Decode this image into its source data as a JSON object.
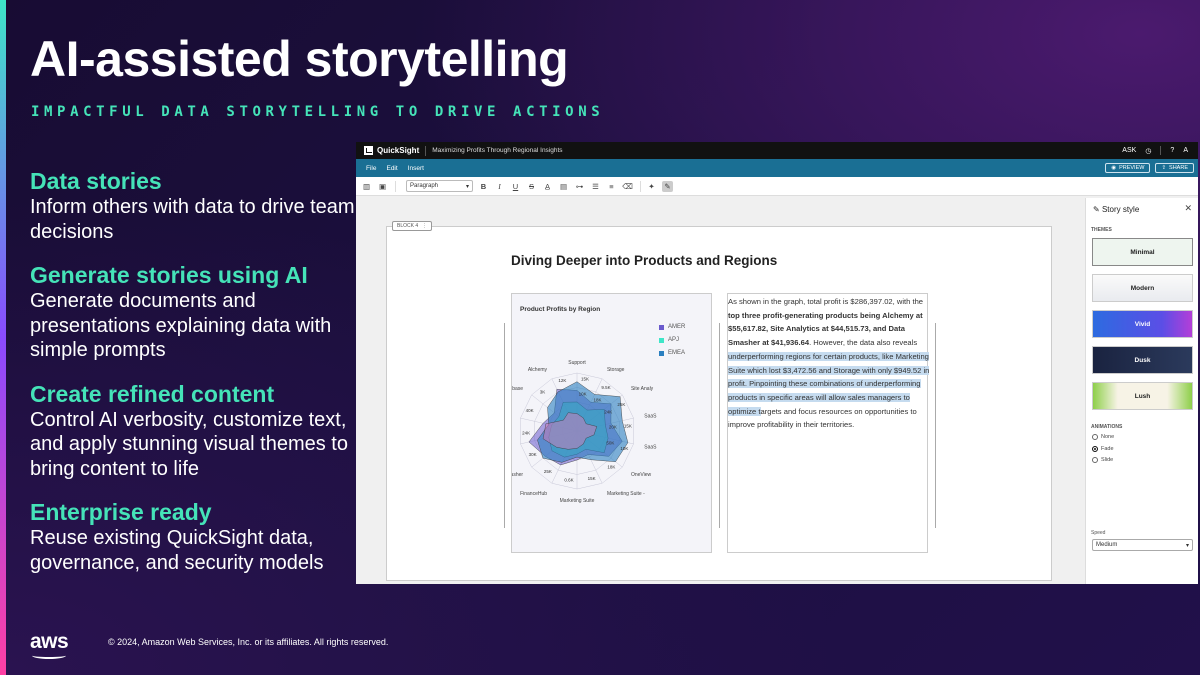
{
  "slide": {
    "title": "AI-assisted storytelling",
    "subtitle": "IMPACTFUL DATA STORYTELLING TO DRIVE ACTIONS",
    "features": [
      {
        "heading": "Data stories",
        "body": "Inform others with data to drive team decisions"
      },
      {
        "heading": "Generate stories using AI",
        "body": "Generate documents and presentations explaining data with simple prompts"
      },
      {
        "heading": "Create refined content",
        "body": "Control AI verbosity, customize text, and apply stunning visual themes to bring content to life"
      },
      {
        "heading": "Enterprise ready",
        "body": "Reuse existing QuickSight data, governance, and security models"
      }
    ],
    "logo": "aws",
    "copyright": "© 2024, Amazon Web Services, Inc. or its affiliates. All rights reserved.",
    "colors": {
      "accent": "#45e3b8",
      "background": "#1c1040"
    }
  },
  "app": {
    "brand": "QuickSight",
    "doc_title": "Maximizing Profits Through Regional Insights",
    "top_right": {
      "ask": "ASK",
      "user": "A"
    },
    "menu": [
      "File",
      "Edit",
      "Insert"
    ],
    "preview_label": "PREVIEW",
    "share_label": "SHARE",
    "paragraph_select": "Paragraph",
    "block_label": "BLOCK 4",
    "story_heading": "Diving Deeper into Products and Regions",
    "chart_title": "Product Profits by Region",
    "story_text": {
      "p1": "As shown in the graph, total profit is $286,397.02, with the ",
      "p1_bold_a": "top three profit-generating products being Alchemy at $55,617.82, Site Analytics at $44,515.73, and Data Smasher at $41,936.64",
      "p1_end": ". However, the data also reveals ",
      "hl_1": "underperforming regions for certain products, like Marketing Suite which lost $3,472.56 and Storage with only $949.52 in profit. Pinpointing these combinations of underperforming products in specific areas will allow sales managers to optimize t",
      "p2": "argets and focus resources on opportunities to improve profitability in their territories."
    },
    "story_style": {
      "title": "Story style",
      "themes_label": "THEMES",
      "themes": [
        {
          "name": "Minimal",
          "bg": "#eef5ef",
          "fg": "#222"
        },
        {
          "name": "Modern",
          "bg": "#f2f3f5",
          "fg": "#222"
        },
        {
          "name": "Vivid",
          "bg": "#3b5fe0",
          "fg": "#fff"
        },
        {
          "name": "Dusk",
          "bg": "#1f2a44",
          "fg": "#fff"
        },
        {
          "name": "Lush",
          "bg": "#e9f5d8",
          "fg": "#222"
        }
      ],
      "animations_label": "ANIMATIONS",
      "animations": [
        "None",
        "Fade",
        "Slide"
      ],
      "animation_selected": "Fade",
      "speed_label": "Speed",
      "speed_value": "Medium"
    }
  },
  "chart_data": {
    "type": "radar",
    "title": "Product Profits by Region",
    "series": [
      {
        "name": "AMER",
        "color": "#6a5acd"
      },
      {
        "name": "APJ",
        "color": "#3ee6c8"
      },
      {
        "name": "EMEA",
        "color": "#2a7fc0"
      }
    ],
    "categories": [
      "Support",
      "Storage",
      "Site Analy",
      "SaaS",
      "SaaS",
      "OneView",
      "Marketing Suite -",
      "Marketing Suite",
      "FinanceHub",
      "Smasher",
      "cher",
      "ugin",
      "Database",
      "Alchemy"
    ],
    "tick_labels": [
      "15K",
      "9.5K",
      "25K",
      "15K",
      "10K",
      "18K",
      "15K",
      "0.6K",
      "25K",
      "30K",
      "24K",
      "40K",
      "3K",
      "12K",
      "10K",
      "18K",
      "24K",
      "20K",
      "50K"
    ]
  }
}
